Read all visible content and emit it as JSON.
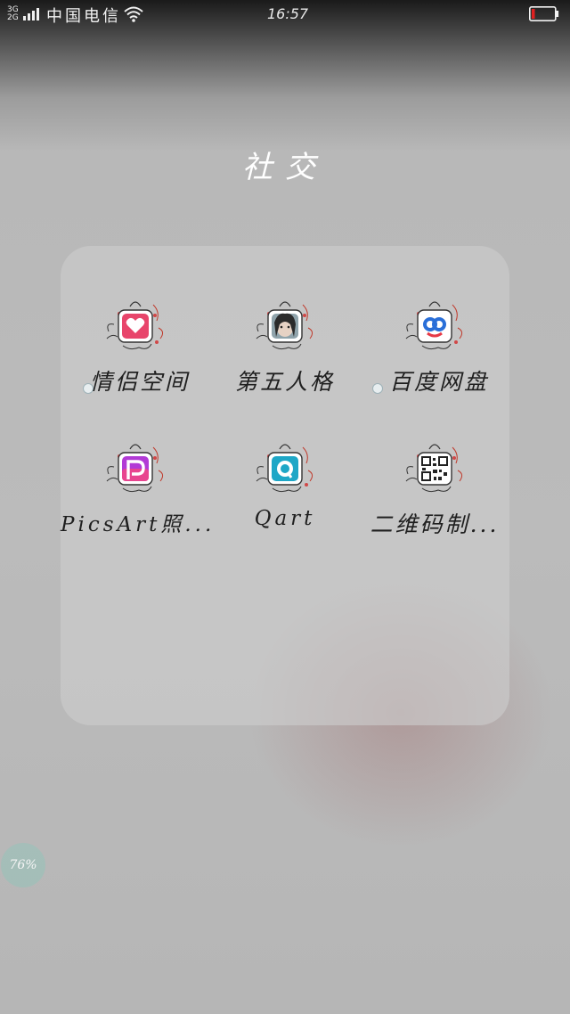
{
  "status_bar": {
    "net_type_top": "3G",
    "net_type_bottom": "2G",
    "carrier": "中国电信",
    "time": "16:57",
    "battery_color": "#e02020"
  },
  "folder": {
    "title": "社交",
    "apps": [
      {
        "label": "情侣空间",
        "icon": "couple-space-icon",
        "accent": "#e8456b",
        "new_badge": true
      },
      {
        "label": "第五人格",
        "icon": "identity-v-icon",
        "accent": "#6a7f8a",
        "new_badge": false
      },
      {
        "label": "百度网盘",
        "icon": "baidu-netdisk-icon",
        "accent": "#2a6fd8",
        "new_badge": true
      },
      {
        "label": "PicsArt照...",
        "icon": "picsart-icon",
        "accent": "#b23bd6",
        "new_badge": false
      },
      {
        "label": "Qart",
        "icon": "qart-icon",
        "accent": "#1ea7c7",
        "new_badge": false
      },
      {
        "label": "二维码制...",
        "icon": "qr-code-icon",
        "accent": "#222222",
        "new_badge": false
      }
    ]
  },
  "memory_bubble": {
    "text": "76%"
  }
}
